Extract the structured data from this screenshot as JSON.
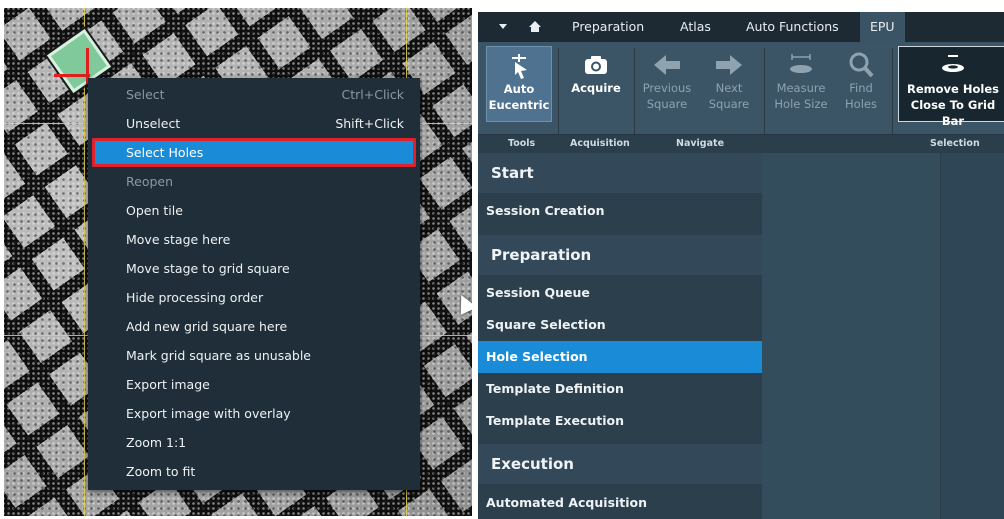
{
  "context_menu": {
    "items": [
      {
        "label": "Select",
        "shortcut": "Ctrl+Click",
        "disabled": true
      },
      {
        "label": "Unselect",
        "shortcut": "Shift+Click",
        "disabled": false
      },
      {
        "label": "Select Holes",
        "shortcut": "",
        "selected": true
      },
      {
        "label": "Reopen",
        "shortcut": "",
        "disabled": true
      },
      {
        "label": "Open tile",
        "shortcut": ""
      },
      {
        "label": "Move stage here",
        "shortcut": ""
      },
      {
        "label": "Move stage to grid square",
        "shortcut": ""
      },
      {
        "label": "Hide processing order",
        "shortcut": ""
      },
      {
        "label": "Add new grid square here",
        "shortcut": ""
      },
      {
        "label": "Mark grid square as unusable",
        "shortcut": ""
      },
      {
        "label": "Export image",
        "shortcut": ""
      },
      {
        "label": "Export image with overlay",
        "shortcut": ""
      },
      {
        "label": "Zoom 1:1",
        "shortcut": ""
      },
      {
        "label": "Zoom to fit",
        "shortcut": ""
      }
    ]
  },
  "tabs": {
    "preparation": "Preparation",
    "atlas": "Atlas",
    "auto_functions": "Auto Functions",
    "epu": "EPU"
  },
  "ribbon": {
    "auto_eucentric": {
      "line1": "Auto",
      "line2": "Eucentric"
    },
    "acquire": "Acquire",
    "previous_square": {
      "line1": "Previous",
      "line2": "Square"
    },
    "next_square": {
      "line1": "Next",
      "line2": "Square"
    },
    "measure_hole_size": {
      "line1": "Measure",
      "line2": "Hole Size"
    },
    "find_holes": {
      "line1": "Find",
      "line2": "Holes"
    },
    "remove_holes": {
      "line1": "Remove Holes",
      "line2": "Close To Grid Bar"
    },
    "groups": {
      "tools": "Tools",
      "acquisition": "Acquisition",
      "navigate": "Navigate",
      "selection": "Selection"
    }
  },
  "workflow": {
    "start_header": "Start",
    "session_creation": "Session Creation",
    "preparation_header": "Preparation",
    "session_queue": "Session Queue",
    "square_selection": "Square Selection",
    "hole_selection": "Hole Selection",
    "template_definition": "Template Definition",
    "template_execution": "Template Execution",
    "execution_header": "Execution",
    "automated_acquisition": "Automated Acquisition"
  },
  "colors": {
    "highlight": "#1a8bd6",
    "menu_bg": "#1f2e38",
    "annotation_red": "#e0202a",
    "grid_line_yellow": "#e6d64a"
  }
}
